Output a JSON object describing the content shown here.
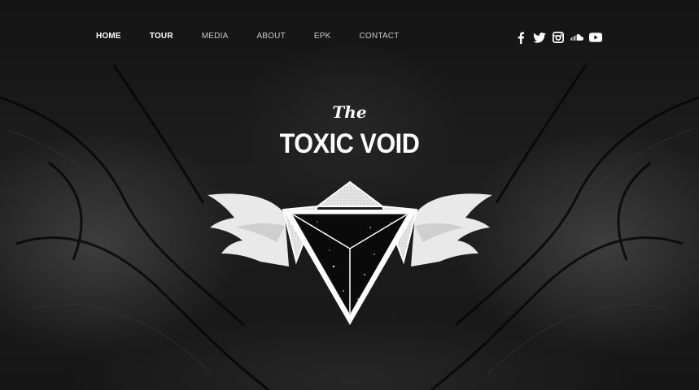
{
  "nav": {
    "items": [
      {
        "label": "HOME"
      },
      {
        "label": "TOUR"
      },
      {
        "label": "MEDIA"
      },
      {
        "label": "ABOUT"
      },
      {
        "label": "EPK"
      },
      {
        "label": "CONTACT"
      }
    ]
  },
  "social": {
    "icons": [
      "facebook-icon",
      "twitter-icon",
      "instagram-icon",
      "soundcloud-icon",
      "youtube-icon"
    ]
  },
  "hero": {
    "the": "The",
    "title": "TOXIC VOID"
  },
  "colors": {
    "background": "#0d0d0d",
    "text": "#ffffff",
    "nav_inactive": "#c9c9c9"
  }
}
